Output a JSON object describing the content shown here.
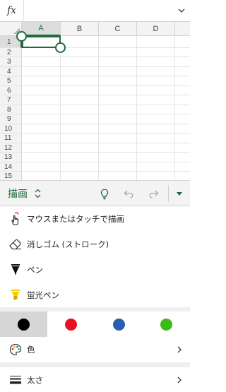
{
  "formula_bar": {
    "fx_label": "fx",
    "value": ""
  },
  "grid": {
    "columns": [
      "A",
      "B",
      "C",
      "D"
    ],
    "rows": [
      "1",
      "2",
      "3",
      "4",
      "5",
      "6",
      "7",
      "8",
      "9",
      "10",
      "11",
      "12",
      "13",
      "14",
      "15"
    ],
    "selected_cell": "A1"
  },
  "toolbar": {
    "tab_label": "描画",
    "icons": [
      "lightbulb-icon",
      "undo-icon",
      "redo-icon",
      "dropdown-arrow-icon"
    ],
    "accent_color": "#1e6a3a"
  },
  "menu": {
    "draw_label": "マウスまたはタッチで描画",
    "eraser_label": "消しゴム (ストローク)",
    "pen_label": "ペン",
    "highlighter_label": "蛍光ペン",
    "color_label": "色",
    "thickness_label": "太さ"
  },
  "swatches": [
    {
      "color": "#000000",
      "selected": true
    },
    {
      "color": "#e81123",
      "selected": false
    },
    {
      "color": "#2a5db0",
      "selected": false
    },
    {
      "color": "#3cba18",
      "selected": false
    }
  ]
}
